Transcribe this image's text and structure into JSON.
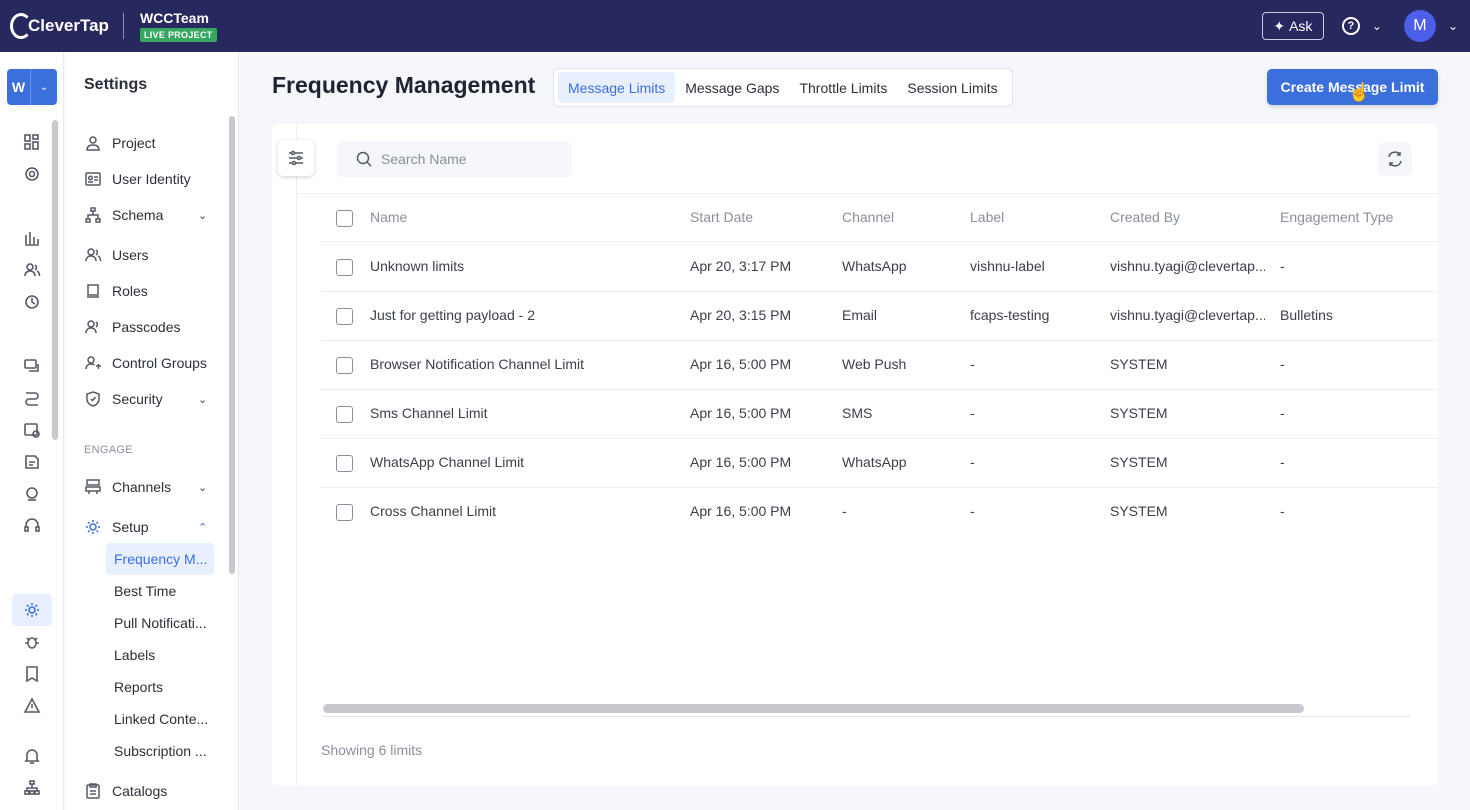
{
  "brand": {
    "logo_text": "CleverTap",
    "team_name": "WCCTeam",
    "project_badge": "LIVE PROJECT"
  },
  "topbar": {
    "ask_label": "Ask",
    "help_icon": "?",
    "avatar_initial": "M"
  },
  "workspace": {
    "initial": "W"
  },
  "rail_icons": [
    "dashboard-icon",
    "analytics-target-icon",
    "bar-chart-icon",
    "segments-icon",
    "journeys-icon",
    "campaigns-icon",
    "flows-icon",
    "schedule-icon",
    "reports-icon",
    "catalog-icon",
    "support-icon",
    "settings-icon",
    "bug-icon",
    "bookmark-icon",
    "alert-icon",
    "notification-icon",
    "hierarchy-icon"
  ],
  "settings": {
    "title": "Settings",
    "items": [
      {
        "label": "Project",
        "icon": "user-icon"
      },
      {
        "label": "User Identity",
        "icon": "id-card-icon"
      },
      {
        "label": "Schema",
        "icon": "schema-icon",
        "expand": "⌄"
      },
      {
        "label": "Users",
        "icon": "users-icon"
      },
      {
        "label": "Roles",
        "icon": "roles-icon"
      },
      {
        "label": "Passcodes",
        "icon": "passcodes-icon"
      },
      {
        "label": "Control Groups",
        "icon": "control-groups-icon"
      },
      {
        "label": "Security",
        "icon": "shield-icon",
        "expand": "⌄"
      }
    ],
    "section_engage": "ENGAGE",
    "channels": {
      "label": "Channels",
      "icon": "channels-icon",
      "expand": "⌄"
    },
    "setup": {
      "label": "Setup",
      "icon": "gear-icon",
      "expand": "⌃"
    },
    "setup_items": [
      "Frequency M...",
      "Best Time",
      "Pull Notificati...",
      "Labels",
      "Reports",
      "Linked Conte...",
      "Subscription ..."
    ],
    "catalogs": {
      "label": "Catalogs",
      "icon": "catalogs-icon"
    }
  },
  "main": {
    "title": "Frequency Management",
    "tabs": [
      "Message Limits",
      "Message Gaps",
      "Throttle Limits",
      "Session Limits"
    ],
    "active_tab": "Message Limits",
    "create_button": "Create Message Limit",
    "search_placeholder": "Search Name",
    "columns": [
      "Name",
      "Start Date",
      "Channel",
      "Label",
      "Created By",
      "Engagement Type"
    ],
    "rows": [
      [
        "Unknown limits",
        "Apr 20, 3:17 PM",
        "WhatsApp",
        "vishnu-label",
        "vishnu.tyagi@clevertap....",
        "-"
      ],
      [
        "Just for getting payload - 2",
        "Apr 20, 3:15 PM",
        "Email",
        "fcaps-testing",
        "vishnu.tyagi@clevertap....",
        "Bulletins"
      ],
      [
        "Browser Notification Channel Limit",
        "Apr 16, 5:00 PM",
        "Web Push",
        "-",
        "SYSTEM",
        "-"
      ],
      [
        "Sms Channel Limit",
        "Apr 16, 5:00 PM",
        "SMS",
        "-",
        "SYSTEM",
        "-"
      ],
      [
        "WhatsApp Channel Limit",
        "Apr 16, 5:00 PM",
        "WhatsApp",
        "-",
        "SYSTEM",
        "-"
      ],
      [
        "Cross Channel Limit",
        "Apr 16, 5:00 PM",
        "-",
        "-",
        "SYSTEM",
        "-"
      ]
    ],
    "footer": "Showing 6 limits"
  },
  "colors": {
    "topbar": "#26285e",
    "accent": "#3a6fdc",
    "live_badge": "#36a661"
  }
}
